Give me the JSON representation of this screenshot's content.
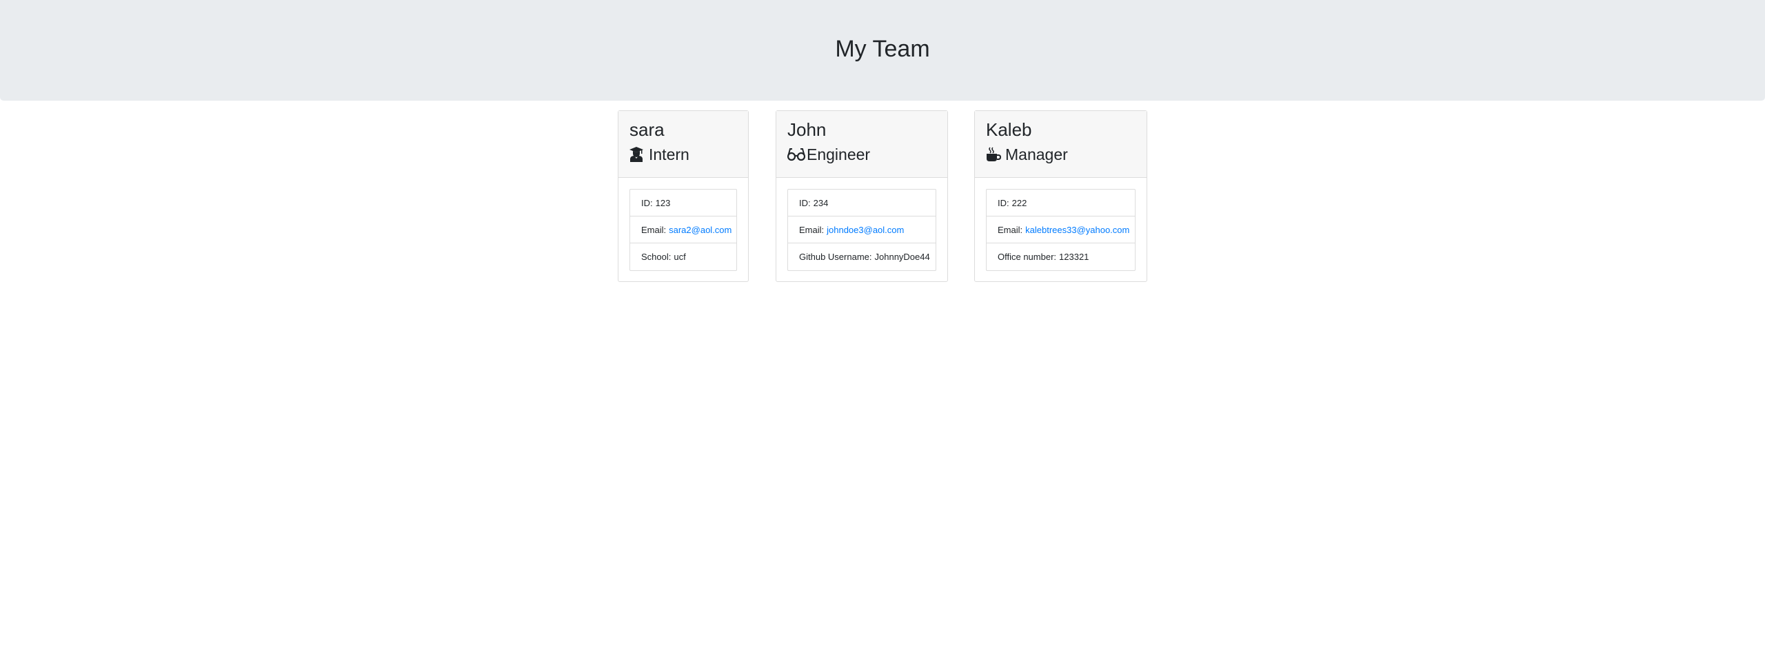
{
  "header": {
    "title": "My Team"
  },
  "cards": [
    {
      "name": "sara",
      "role": "Intern",
      "icon": "graduate-icon",
      "id_label": "ID:",
      "id": "123",
      "email_label": "Email:",
      "email": "sara2@aol.com",
      "extra_label": "School:",
      "extra": "ucf"
    },
    {
      "name": "John",
      "role": "Engineer",
      "icon": "glasses-icon",
      "id_label": "ID:",
      "id": "234",
      "email_label": "Email:",
      "email": "johndoe3@aol.com",
      "extra_label": "Github Username:",
      "extra": "JohnnyDoe44"
    },
    {
      "name": "Kaleb",
      "role": "Manager",
      "icon": "coffee-icon",
      "id_label": "ID:",
      "id": "222",
      "email_label": "Email:",
      "email": "kalebtrees33@yahoo.com",
      "extra_label": "Office number:",
      "extra": "123321"
    }
  ],
  "colors": {
    "header_bg": "#e9ecef",
    "card_header_bg": "#f7f7f7",
    "link": "#007bff",
    "text": "#212529"
  }
}
